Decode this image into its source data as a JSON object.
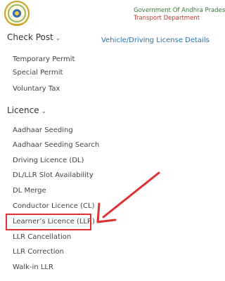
{
  "header": {
    "line1": "Government Of Andhra Pradesh",
    "line2": "Transport Department",
    "emblem_icon": "andhra-pradesh-emblem"
  },
  "top_link": "Vehicle/Driving License Details",
  "check_post": {
    "label": "Check Post",
    "items": [
      {
        "label": "Temporary Permit"
      },
      {
        "label": "Special Permit"
      },
      {
        "label": "Voluntary Tax"
      }
    ]
  },
  "licence": {
    "label": "Licence",
    "items": [
      {
        "label": "Aadhaar Seeding"
      },
      {
        "label": "Aadhaar Seeding Search"
      },
      {
        "label": "Driving Licence (DL)"
      },
      {
        "label": "DL/LLR Slot Availability"
      },
      {
        "label": "DL Merge"
      },
      {
        "label": "Conductor Licence (CL)"
      },
      {
        "label": "Learner’s Licence (LLR)"
      },
      {
        "label": "LLR Cancellation"
      },
      {
        "label": "LLR Correction"
      },
      {
        "label": "Walk-in LLR"
      }
    ]
  },
  "colors": {
    "header_green": "#2e7d32",
    "header_red": "#c0392b",
    "link_blue": "#1f74a8",
    "annotation_red": "#e03030"
  }
}
